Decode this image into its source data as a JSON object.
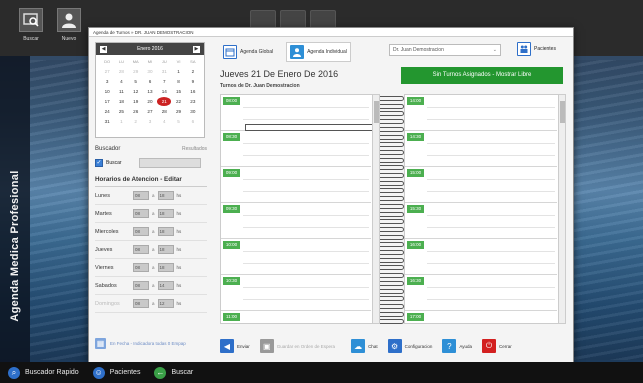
{
  "app": {
    "sidebar_title": "Agenda Medica Profesional"
  },
  "topbar": {
    "buttons": [
      {
        "label": "Buscar",
        "icon": "search-window-icon"
      },
      {
        "label": "Nuevo",
        "icon": "user-icon"
      }
    ]
  },
  "dialog": {
    "title": "Agenda de Turnos » DR. JUAN DEMOSTRACION",
    "calendar": {
      "month_label": "Enero 2016",
      "weekdays": [
        "DO",
        "LU",
        "MA",
        "MI",
        "JU",
        "VI",
        "SA"
      ],
      "weeks": [
        [
          "27",
          "28",
          "29",
          "30",
          "31",
          "1",
          "2"
        ],
        [
          "3",
          "4",
          "5",
          "6",
          "7",
          "8",
          "9"
        ],
        [
          "10",
          "11",
          "12",
          "13",
          "14",
          "15",
          "16"
        ],
        [
          "17",
          "18",
          "19",
          "20",
          "21",
          "22",
          "23"
        ],
        [
          "24",
          "25",
          "26",
          "27",
          "28",
          "29",
          "30"
        ],
        [
          "31",
          "1",
          "2",
          "3",
          "4",
          "5",
          "6"
        ]
      ],
      "selected_day": "21"
    },
    "search": {
      "label": "Buscador",
      "results_label": "Resultados",
      "buscar_label": "Buscar"
    },
    "hours": {
      "title": "Horarios de Atencion - Editar",
      "rows": [
        {
          "day": "Lunes",
          "from": "08",
          "to": "18",
          "sep": "a",
          "suffix": "hs"
        },
        {
          "day": "Martes",
          "from": "08",
          "to": "18",
          "sep": "a",
          "suffix": "hs"
        },
        {
          "day": "Miercoles",
          "from": "08",
          "to": "18",
          "sep": "a",
          "suffix": "hs"
        },
        {
          "day": "Jueves",
          "from": "08",
          "to": "18",
          "sep": "a",
          "suffix": "hs"
        },
        {
          "day": "Viernes",
          "from": "08",
          "to": "18",
          "sep": "a",
          "suffix": "hs"
        },
        {
          "day": "Sabados",
          "from": "08",
          "to": "14",
          "sep": "a",
          "suffix": "hs"
        },
        {
          "day": "Domingos",
          "from": "08",
          "to": "12",
          "sep": "a",
          "suffix": "hs",
          "disabled": true
        }
      ]
    },
    "left_footer": "En Fecha - Indicadora todas 0 Empap",
    "tabs": [
      {
        "label": "Agenda Global"
      },
      {
        "label": "Agenda Individual"
      }
    ],
    "professional_select": "Dr. Juan Demostracion",
    "pacientes_label": "Pacientes",
    "date_title": "Jueves 21 De Enero De 2016",
    "doctor_label": "Turnos de Dr. Juan Demostracion",
    "status_banner": "Sin Turnos Asignados - Mostrar Libre",
    "left_slots": [
      "08:00",
      "08:30",
      "09:00",
      "09:30",
      "10:00",
      "10:30",
      "11:00"
    ],
    "right_slots": [
      "14:00",
      "14:30",
      "15:00",
      "15:30",
      "16:00",
      "16:30",
      "17:00"
    ],
    "actions": [
      {
        "label": "Enviar",
        "icon": "send-icon",
        "color": "#2e6fc9"
      },
      {
        "label": "Guardar en Orden de Espera",
        "icon": "save-icon",
        "color": "#999999",
        "disabled": true
      },
      {
        "label": "Chat",
        "icon": "chat-icon",
        "color": "#2e8fd6"
      },
      {
        "label": "Configuracion",
        "icon": "gear-icon",
        "color": "#2e6fc9"
      },
      {
        "label": "Ayuda",
        "icon": "help-icon",
        "color": "#2e8fd6"
      },
      {
        "label": "Cerrar",
        "icon": "close-icon",
        "color": "#d32020"
      }
    ]
  },
  "bottombar": {
    "items": [
      {
        "label": "Buscador Rapido",
        "color": "#2e6fc9"
      },
      {
        "label": "Pacientes",
        "color": "#2e6fc9"
      },
      {
        "label": "Buscar",
        "color": "#3aa047"
      }
    ]
  }
}
